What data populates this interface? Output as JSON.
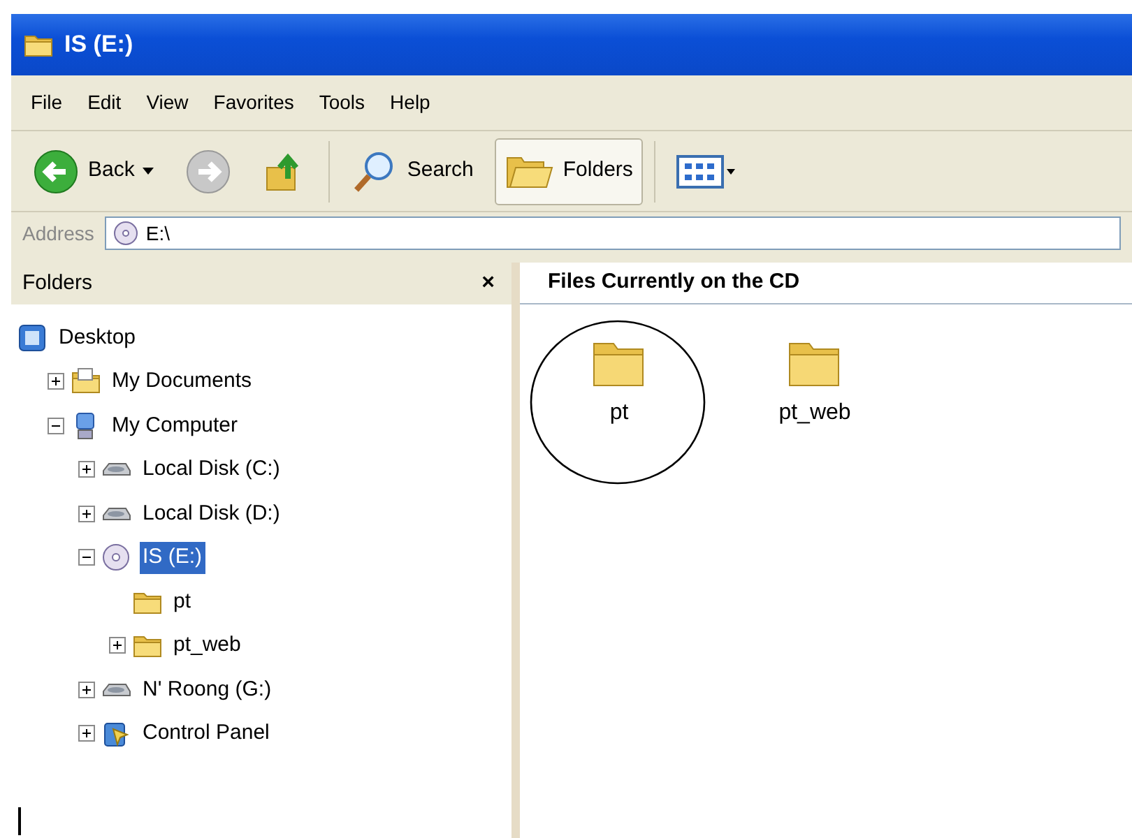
{
  "window": {
    "title": "IS (E:)"
  },
  "menu": [
    "File",
    "Edit",
    "View",
    "Favorites",
    "Tools",
    "Help"
  ],
  "toolbar": [
    {
      "kind": "back",
      "label": "Back",
      "selected": false
    },
    {
      "kind": "forward",
      "selected": false
    },
    {
      "kind": "up",
      "selected": false
    },
    {
      "kind": "search",
      "label": "Search",
      "selected": false
    },
    {
      "kind": "folders",
      "label": "Folders",
      "selected": true
    },
    {
      "kind": "views",
      "selected": false
    }
  ],
  "address": {
    "label": "Address",
    "value": "E:\\"
  },
  "folders_pane": {
    "title": "Folders",
    "close": "×",
    "tree": [
      {
        "label": "Desktop",
        "kind": "desktop",
        "selected": false,
        "children": [
          {
            "label": "My Documents",
            "kind": "documents",
            "expanded": false,
            "selected": false
          },
          {
            "label": "My Computer",
            "kind": "computer",
            "expanded": true,
            "selected": false,
            "children": [
              {
                "label": "Local Disk (C:)",
                "kind": "disk",
                "expanded": false,
                "selected": false
              },
              {
                "label": "Local Disk (D:)",
                "kind": "disk",
                "expanded": false,
                "selected": false
              },
              {
                "label": "IS (E:)",
                "kind": "cd",
                "expanded": true,
                "selected": true,
                "children": [
                  {
                    "label": "pt",
                    "kind": "folder",
                    "selected": false
                  },
                  {
                    "label": "pt_web",
                    "kind": "folder",
                    "expanded": false,
                    "selected": false
                  }
                ]
              },
              {
                "label": "N' Roong (G:)",
                "kind": "disk",
                "expanded": false,
                "selected": false
              },
              {
                "label": "Control Panel",
                "kind": "control-panel",
                "expanded": false,
                "selected": false
              }
            ]
          }
        ]
      }
    ]
  },
  "content": {
    "heading": "Files Currently on the CD",
    "items": [
      {
        "label": "pt",
        "circled": true
      },
      {
        "label": "pt_web",
        "circled": false
      }
    ]
  }
}
